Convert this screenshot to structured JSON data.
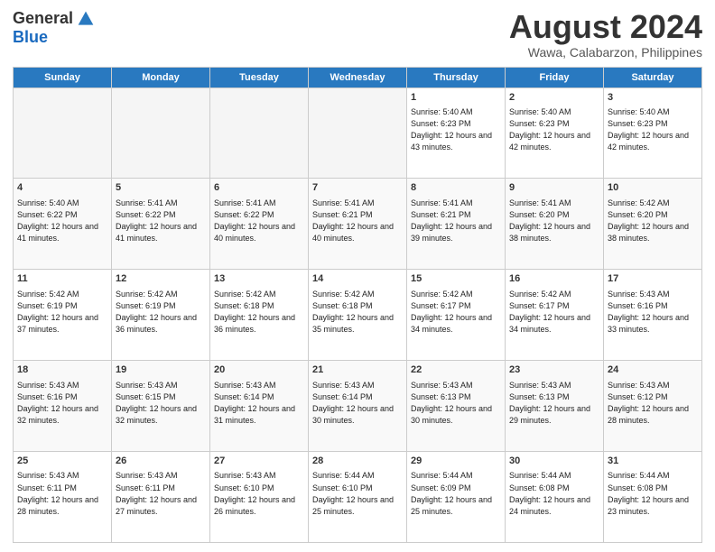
{
  "logo": {
    "general": "General",
    "blue": "Blue"
  },
  "header": {
    "month": "August 2024",
    "location": "Wawa, Calabarzon, Philippines"
  },
  "days_of_week": [
    "Sunday",
    "Monday",
    "Tuesday",
    "Wednesday",
    "Thursday",
    "Friday",
    "Saturday"
  ],
  "weeks": [
    [
      {
        "num": "",
        "empty": true
      },
      {
        "num": "",
        "empty": true
      },
      {
        "num": "",
        "empty": true
      },
      {
        "num": "",
        "empty": true
      },
      {
        "num": "1",
        "sunrise": "5:40 AM",
        "sunset": "6:23 PM",
        "daylight": "12 hours and 43 minutes."
      },
      {
        "num": "2",
        "sunrise": "5:40 AM",
        "sunset": "6:23 PM",
        "daylight": "12 hours and 42 minutes."
      },
      {
        "num": "3",
        "sunrise": "5:40 AM",
        "sunset": "6:23 PM",
        "daylight": "12 hours and 42 minutes."
      }
    ],
    [
      {
        "num": "4",
        "sunrise": "5:40 AM",
        "sunset": "6:22 PM",
        "daylight": "12 hours and 41 minutes."
      },
      {
        "num": "5",
        "sunrise": "5:41 AM",
        "sunset": "6:22 PM",
        "daylight": "12 hours and 41 minutes."
      },
      {
        "num": "6",
        "sunrise": "5:41 AM",
        "sunset": "6:22 PM",
        "daylight": "12 hours and 40 minutes."
      },
      {
        "num": "7",
        "sunrise": "5:41 AM",
        "sunset": "6:21 PM",
        "daylight": "12 hours and 40 minutes."
      },
      {
        "num": "8",
        "sunrise": "5:41 AM",
        "sunset": "6:21 PM",
        "daylight": "12 hours and 39 minutes."
      },
      {
        "num": "9",
        "sunrise": "5:41 AM",
        "sunset": "6:20 PM",
        "daylight": "12 hours and 38 minutes."
      },
      {
        "num": "10",
        "sunrise": "5:42 AM",
        "sunset": "6:20 PM",
        "daylight": "12 hours and 38 minutes."
      }
    ],
    [
      {
        "num": "11",
        "sunrise": "5:42 AM",
        "sunset": "6:19 PM",
        "daylight": "12 hours and 37 minutes."
      },
      {
        "num": "12",
        "sunrise": "5:42 AM",
        "sunset": "6:19 PM",
        "daylight": "12 hours and 36 minutes."
      },
      {
        "num": "13",
        "sunrise": "5:42 AM",
        "sunset": "6:18 PM",
        "daylight": "12 hours and 36 minutes."
      },
      {
        "num": "14",
        "sunrise": "5:42 AM",
        "sunset": "6:18 PM",
        "daylight": "12 hours and 35 minutes."
      },
      {
        "num": "15",
        "sunrise": "5:42 AM",
        "sunset": "6:17 PM",
        "daylight": "12 hours and 34 minutes."
      },
      {
        "num": "16",
        "sunrise": "5:42 AM",
        "sunset": "6:17 PM",
        "daylight": "12 hours and 34 minutes."
      },
      {
        "num": "17",
        "sunrise": "5:43 AM",
        "sunset": "6:16 PM",
        "daylight": "12 hours and 33 minutes."
      }
    ],
    [
      {
        "num": "18",
        "sunrise": "5:43 AM",
        "sunset": "6:16 PM",
        "daylight": "12 hours and 32 minutes."
      },
      {
        "num": "19",
        "sunrise": "5:43 AM",
        "sunset": "6:15 PM",
        "daylight": "12 hours and 32 minutes."
      },
      {
        "num": "20",
        "sunrise": "5:43 AM",
        "sunset": "6:14 PM",
        "daylight": "12 hours and 31 minutes."
      },
      {
        "num": "21",
        "sunrise": "5:43 AM",
        "sunset": "6:14 PM",
        "daylight": "12 hours and 30 minutes."
      },
      {
        "num": "22",
        "sunrise": "5:43 AM",
        "sunset": "6:13 PM",
        "daylight": "12 hours and 30 minutes."
      },
      {
        "num": "23",
        "sunrise": "5:43 AM",
        "sunset": "6:13 PM",
        "daylight": "12 hours and 29 minutes."
      },
      {
        "num": "24",
        "sunrise": "5:43 AM",
        "sunset": "6:12 PM",
        "daylight": "12 hours and 28 minutes."
      }
    ],
    [
      {
        "num": "25",
        "sunrise": "5:43 AM",
        "sunset": "6:11 PM",
        "daylight": "12 hours and 28 minutes."
      },
      {
        "num": "26",
        "sunrise": "5:43 AM",
        "sunset": "6:11 PM",
        "daylight": "12 hours and 27 minutes."
      },
      {
        "num": "27",
        "sunrise": "5:43 AM",
        "sunset": "6:10 PM",
        "daylight": "12 hours and 26 minutes."
      },
      {
        "num": "28",
        "sunrise": "5:44 AM",
        "sunset": "6:10 PM",
        "daylight": "12 hours and 25 minutes."
      },
      {
        "num": "29",
        "sunrise": "5:44 AM",
        "sunset": "6:09 PM",
        "daylight": "12 hours and 25 minutes."
      },
      {
        "num": "30",
        "sunrise": "5:44 AM",
        "sunset": "6:08 PM",
        "daylight": "12 hours and 24 minutes."
      },
      {
        "num": "31",
        "sunrise": "5:44 AM",
        "sunset": "6:08 PM",
        "daylight": "12 hours and 23 minutes."
      }
    ]
  ],
  "labels": {
    "sunrise": "Sunrise:",
    "sunset": "Sunset:",
    "daylight": "Daylight:"
  }
}
